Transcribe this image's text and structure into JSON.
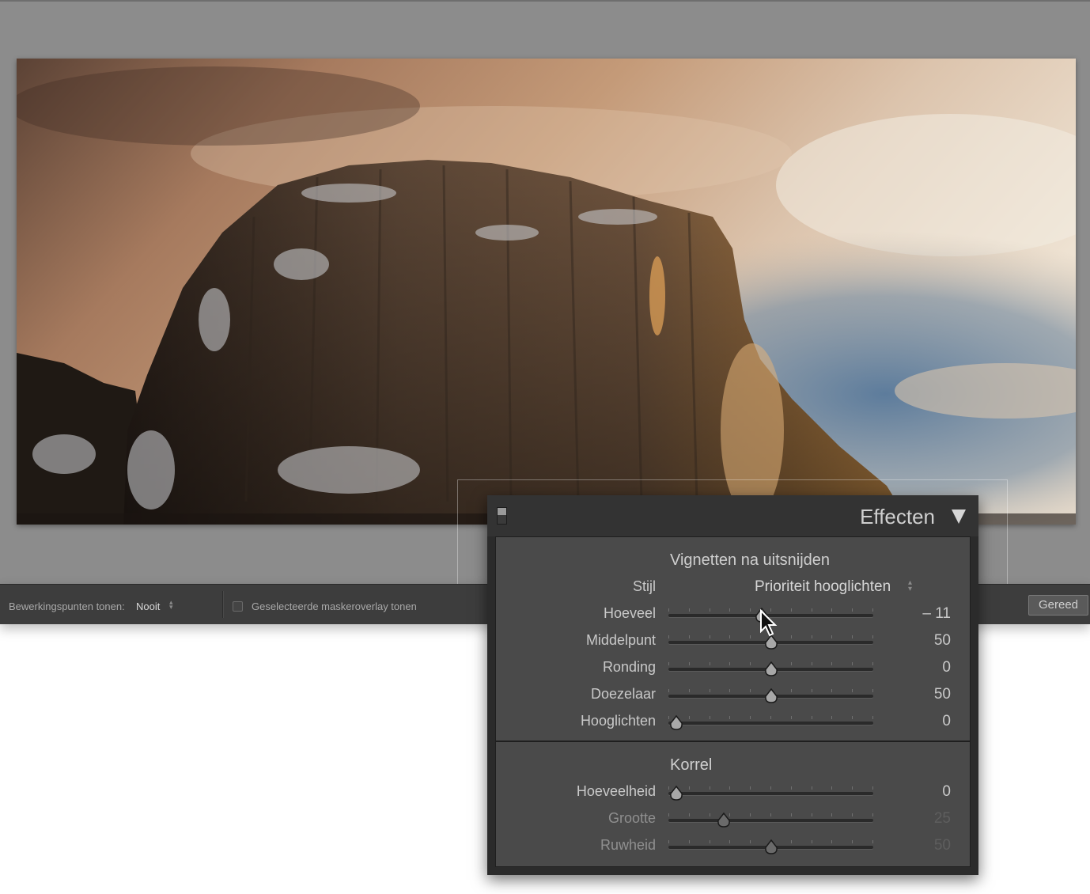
{
  "toolbar": {
    "show_points_label": "Bewerkingspunten tonen:",
    "show_points_value": "Nooit",
    "mask_overlay_label": "Geselecteerde maskeroverlay tonen",
    "done_label": "Gereed"
  },
  "panel": {
    "title": "Effecten",
    "vignette": {
      "title": "Vignetten na uitsnijden",
      "style_label": "Stijl",
      "style_value": "Prioriteit hooglichten",
      "sliders": [
        {
          "label": "Hoeveel",
          "value": "– 11",
          "position": 0.45
        },
        {
          "label": "Middelpunt",
          "value": "50",
          "position": 0.5
        },
        {
          "label": "Ronding",
          "value": "0",
          "position": 0.5
        },
        {
          "label": "Doezelaar",
          "value": "50",
          "position": 0.5
        },
        {
          "label": "Hooglichten",
          "value": "0",
          "position": 0.0
        }
      ]
    },
    "grain": {
      "title": "Korrel",
      "sliders": [
        {
          "label": "Hoeveelheid",
          "value": "0",
          "position": 0.0
        },
        {
          "label": "Grootte",
          "value": "25",
          "position": 0.25
        },
        {
          "label": "Ruwheid",
          "value": "50",
          "position": 0.5
        }
      ]
    }
  },
  "colors": {
    "workspace": "#8c8c8c",
    "panel_section": "#4a4a4a",
    "toolbar": "#3d3d3d"
  }
}
